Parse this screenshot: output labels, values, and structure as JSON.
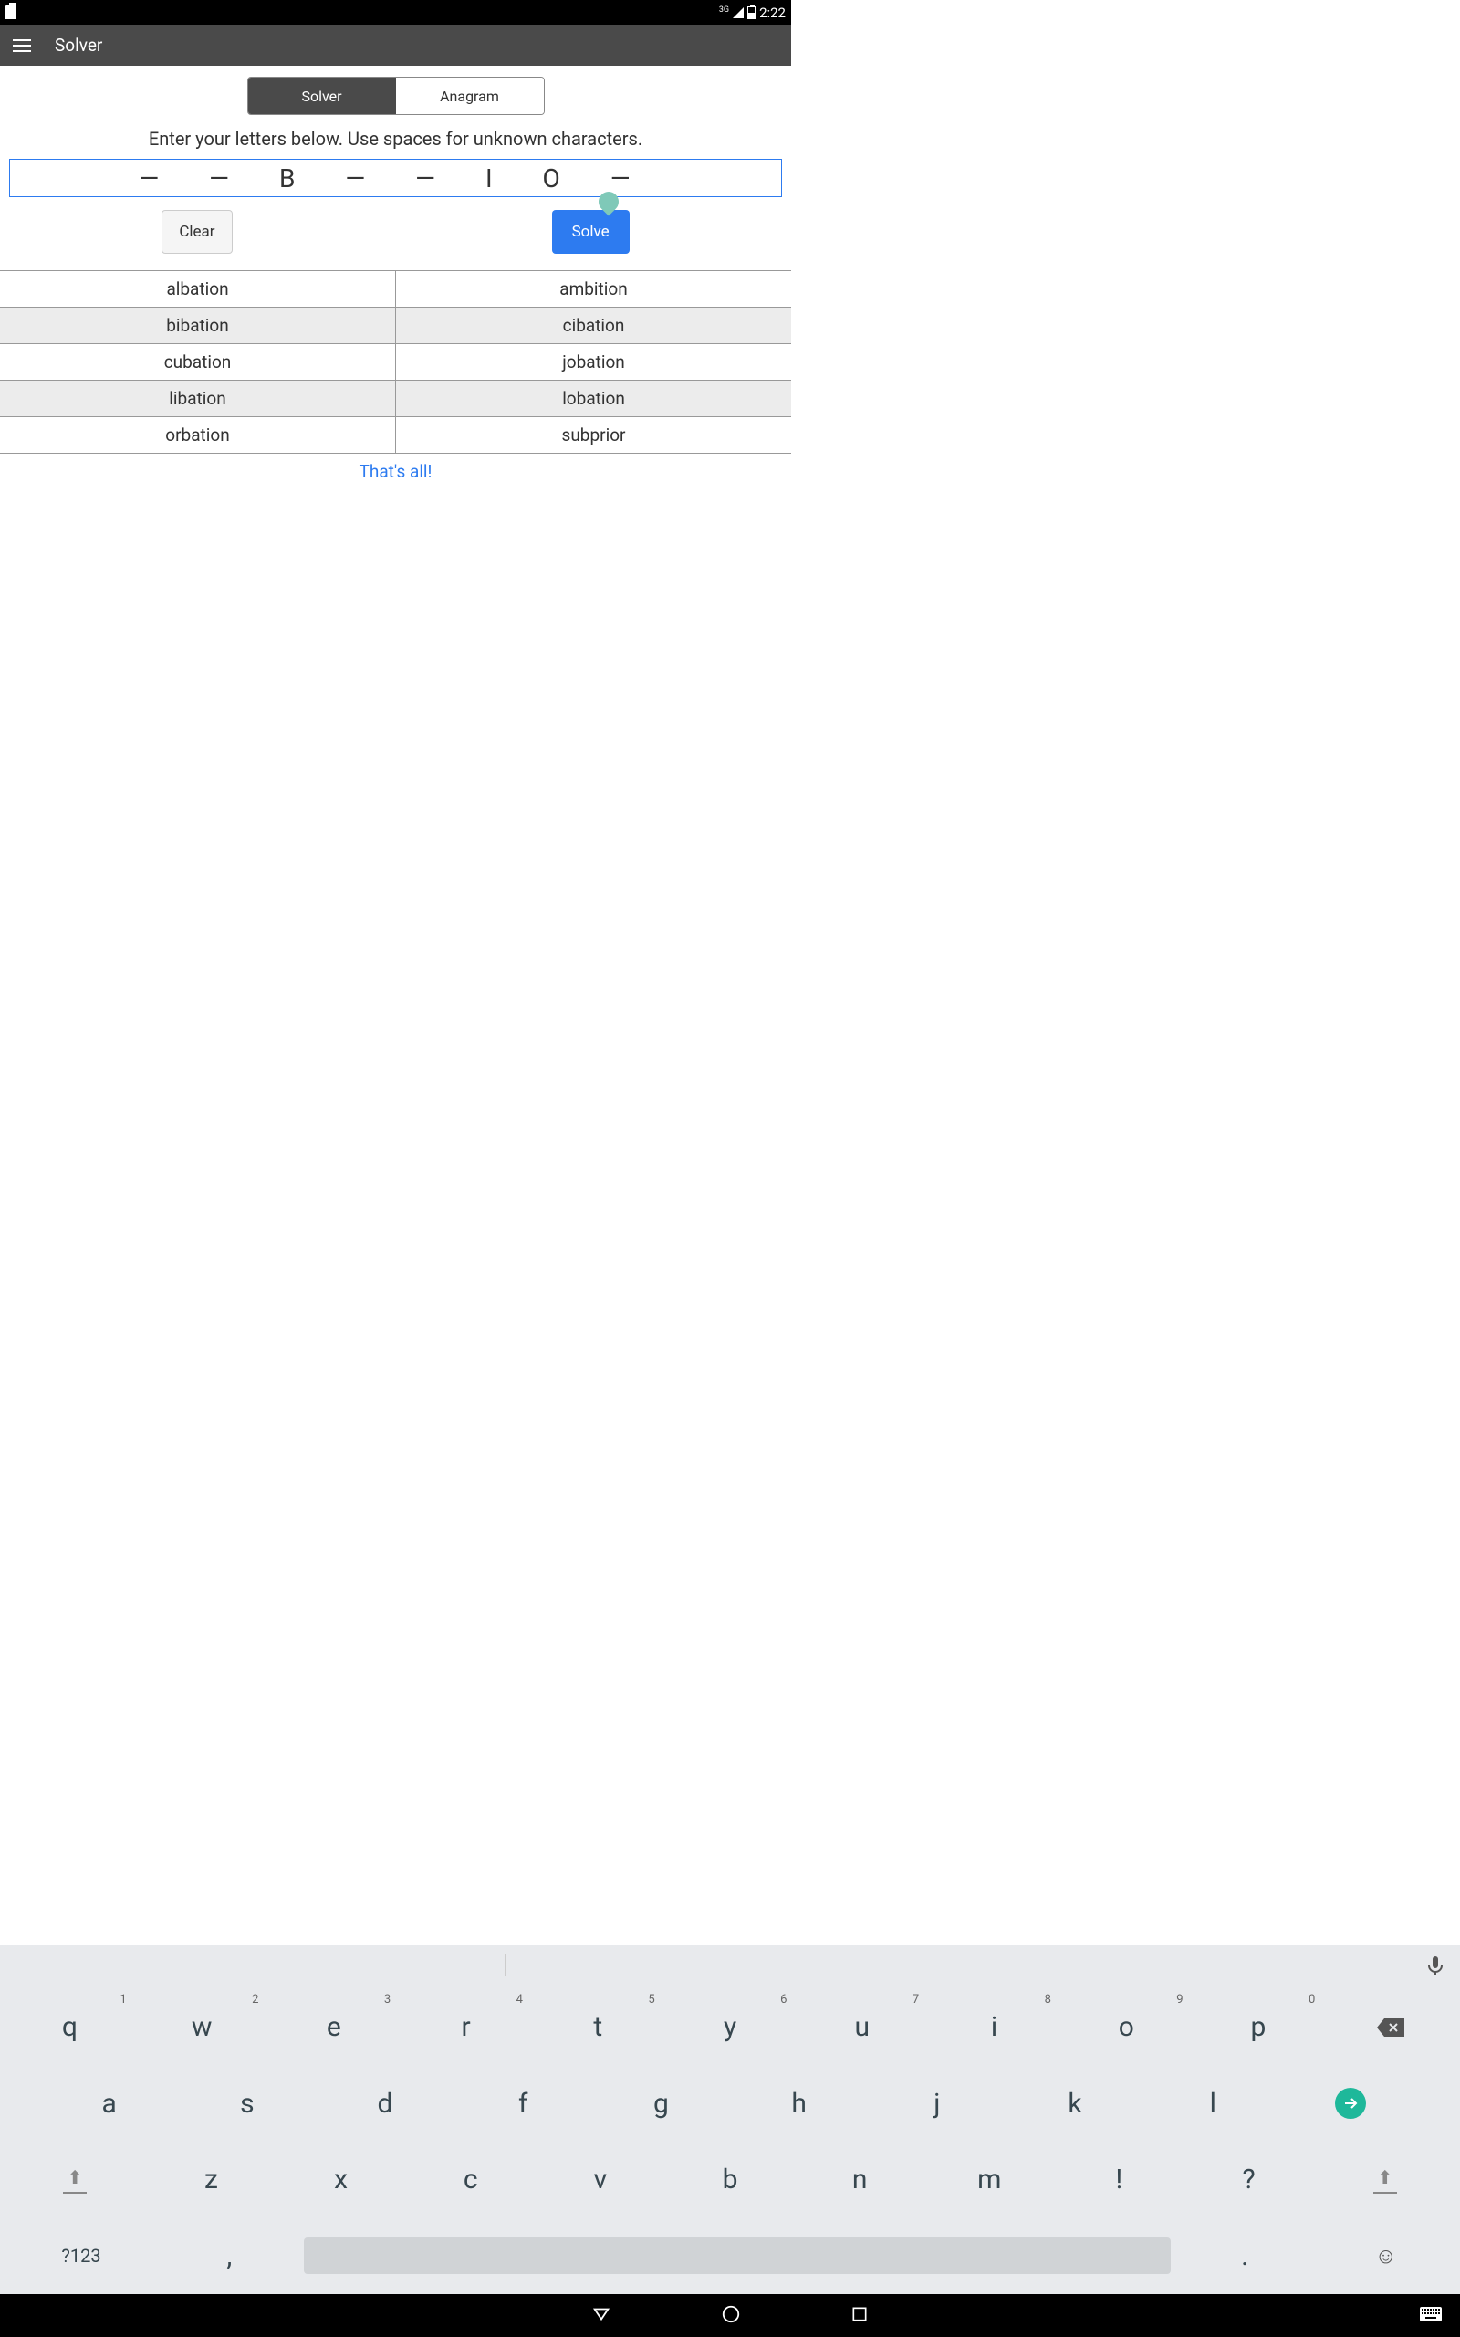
{
  "status": {
    "network": "3G",
    "time": "2:22"
  },
  "appbar": {
    "title": "Solver"
  },
  "tabs": {
    "solver": "Solver",
    "anagram": "Anagram"
  },
  "instruction": "Enter your letters below. Use spaces for unknown characters.",
  "input": {
    "value": "— — B — — I O —"
  },
  "buttons": {
    "clear": "Clear",
    "solve": "Solve"
  },
  "results": [
    [
      "albation",
      "ambition"
    ],
    [
      "bibation",
      "cibation"
    ],
    [
      "cubation",
      "jobation"
    ],
    [
      "libation",
      "lobation"
    ],
    [
      "orbation",
      "subprior"
    ]
  ],
  "thats_all": "That's all!",
  "keyboard": {
    "row1": [
      {
        "k": "q",
        "s": "1"
      },
      {
        "k": "w",
        "s": "2"
      },
      {
        "k": "e",
        "s": "3"
      },
      {
        "k": "r",
        "s": "4"
      },
      {
        "k": "t",
        "s": "5"
      },
      {
        "k": "y",
        "s": "6"
      },
      {
        "k": "u",
        "s": "7"
      },
      {
        "k": "i",
        "s": "8"
      },
      {
        "k": "o",
        "s": "9"
      },
      {
        "k": "p",
        "s": "0"
      }
    ],
    "row2": [
      "a",
      "s",
      "d",
      "f",
      "g",
      "h",
      "j",
      "k",
      "l"
    ],
    "row3": [
      "z",
      "x",
      "c",
      "v",
      "b",
      "n",
      "m",
      "!",
      "?"
    ],
    "sym": "?123",
    "comma": ",",
    "period": "."
  }
}
